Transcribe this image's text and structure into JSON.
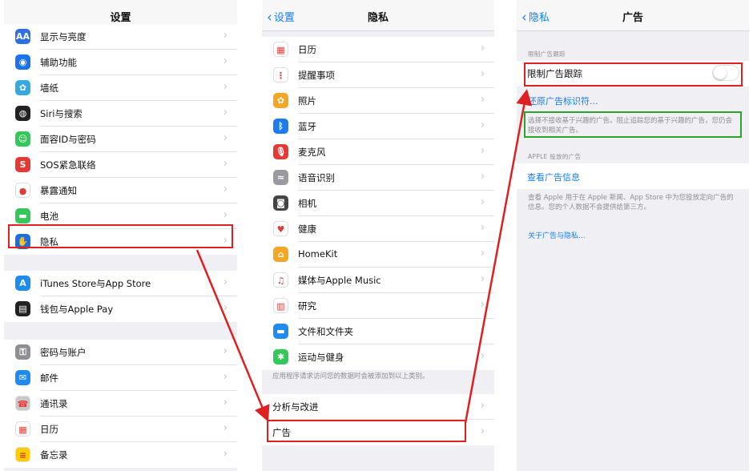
{
  "colors": {
    "accent": "#157efb",
    "highlight_red": "#e02020",
    "highlight_green": "#2aa52a"
  },
  "panel1": {
    "title": "设置",
    "group1": [
      {
        "label": "显示与亮度",
        "icon": "display-icon",
        "color": "#2f6fe0",
        "glyph": "AA"
      },
      {
        "label": "辅助功能",
        "icon": "accessibility-icon",
        "color": "#1a73e8",
        "glyph": "◉"
      },
      {
        "label": "墙纸",
        "icon": "wallpaper-icon",
        "color": "#36a9e1",
        "glyph": "✿"
      },
      {
        "label": "Siri与搜索",
        "icon": "siri-icon",
        "color": "#222",
        "glyph": "◍"
      },
      {
        "label": "面容ID与密码",
        "icon": "faceid-icon",
        "color": "#34c759",
        "glyph": "☺"
      },
      {
        "label": "SOS紧急联络",
        "icon": "sos-icon",
        "color": "#e53935",
        "glyph": "S"
      },
      {
        "label": "暴露通知",
        "icon": "exposure-icon",
        "color": "#fff",
        "glyph": "●"
      },
      {
        "label": "电池",
        "icon": "battery-icon",
        "color": "#34c759",
        "glyph": "▬"
      },
      {
        "label": "隐私",
        "icon": "privacy-hand-icon",
        "color": "#1a6fe0",
        "glyph": "✋"
      }
    ],
    "group2": [
      {
        "label": "iTunes Store与App Store",
        "icon": "appstore-icon",
        "color": "#1e8bf0",
        "glyph": "A"
      },
      {
        "label": "钱包与Apple Pay",
        "icon": "wallet-icon",
        "color": "#222",
        "glyph": "▤"
      }
    ],
    "group3": [
      {
        "label": "密码与账户",
        "icon": "key-icon",
        "color": "#8e8e93",
        "glyph": "⚿"
      },
      {
        "label": "邮件",
        "icon": "mail-icon",
        "color": "#1e8bf0",
        "glyph": "✉"
      },
      {
        "label": "通讯录",
        "icon": "contacts-icon",
        "color": "#c8c8c8",
        "glyph": "☎"
      },
      {
        "label": "日历",
        "icon": "calendar-icon",
        "color": "#fff",
        "glyph": "▦"
      },
      {
        "label": "备忘录",
        "icon": "notes-icon",
        "color": "#ffcc00",
        "glyph": "≡"
      }
    ]
  },
  "panel2": {
    "back": "设置",
    "title": "隐私",
    "items": [
      {
        "label": "日历",
        "icon": "calendar-icon",
        "color": "#fff",
        "glyph": "▦"
      },
      {
        "label": "提醒事项",
        "icon": "reminders-icon",
        "color": "#fff",
        "glyph": "⋮"
      },
      {
        "label": "照片",
        "icon": "photos-icon",
        "color": "#f5a623",
        "glyph": "✿"
      },
      {
        "label": "蓝牙",
        "icon": "bluetooth-icon",
        "color": "#1e7bf0",
        "glyph": "ᛒ"
      },
      {
        "label": "麦克风",
        "icon": "microphone-icon",
        "color": "#e53935",
        "glyph": "🎙"
      },
      {
        "label": "语音识别",
        "icon": "speech-recognition-icon",
        "color": "#9a9aa0",
        "glyph": "≈"
      },
      {
        "label": "相机",
        "icon": "camera-icon",
        "color": "#444",
        "glyph": "◙"
      },
      {
        "label": "健康",
        "icon": "health-icon",
        "color": "#fff",
        "glyph": "♥"
      },
      {
        "label": "HomeKit",
        "icon": "homekit-icon",
        "color": "#f5a623",
        "glyph": "⌂"
      },
      {
        "label": "媒体与Apple Music",
        "icon": "music-icon",
        "color": "#fff",
        "glyph": "♫"
      },
      {
        "label": "研究",
        "icon": "research-icon",
        "color": "#fff",
        "glyph": "▥"
      },
      {
        "label": "文件和文件夹",
        "icon": "folder-icon",
        "color": "#1e8bf0",
        "glyph": "▬"
      },
      {
        "label": "运动与健身",
        "icon": "fitness-icon",
        "color": "#34c759",
        "glyph": "✱"
      }
    ],
    "footnote": "应用程序请求访问您的数据时会被添加到以上类别。",
    "items2": [
      {
        "label": "分析与改进"
      },
      {
        "label": "广告"
      }
    ]
  },
  "panel3": {
    "back": "隐私",
    "title": "广告",
    "section1": "限制广告跟踪",
    "toggle_label": "限制广告跟踪",
    "toggle_on": false,
    "reset_link": "还原广告标识符...",
    "note1": "选择不接收基于兴趣的广告。阻止追踪您的基于兴趣的广告，您仍会接收到相关广告。",
    "section2": "APPLE 投放的广告",
    "view_link": "查看广告信息",
    "note2": "查看 Apple 用于在 Apple 新闻、App Store 中为您投放定向广告的信息。您的个人数据不会提供给第三方。",
    "about_link": "关于广告与隐私..."
  }
}
